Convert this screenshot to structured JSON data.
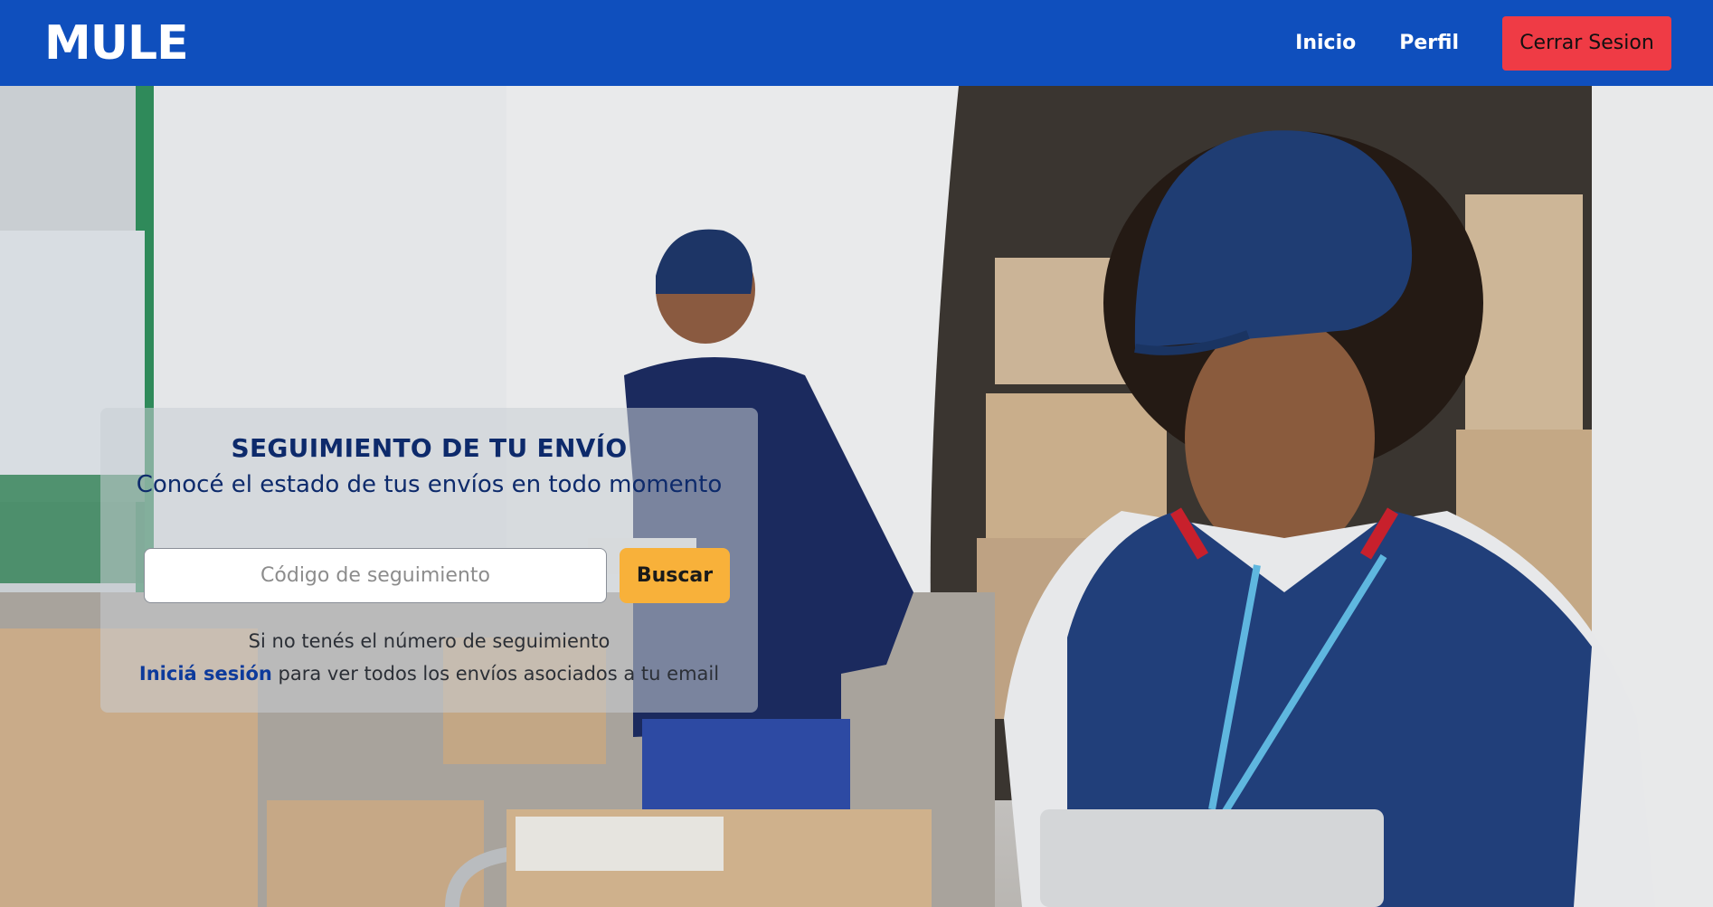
{
  "navbar": {
    "brand": "MULE",
    "links": [
      {
        "label": "Inicio"
      },
      {
        "label": "Perfil"
      }
    ],
    "logout_label": "Cerrar Sesion",
    "colors": {
      "background": "#0f4fbd",
      "logout": "#ef3b45"
    }
  },
  "hero": {
    "image": "delivery-workers-photo",
    "card": {
      "title": "SEGUIMIENTO DE TU ENVÍO",
      "subtitle": "Conocé el estado de tus envíos en todo momento",
      "input_placeholder": "Código de seguimiento",
      "input_value": "",
      "search_label": "Buscar",
      "hint_line1": "Si no tenés el número de seguimiento",
      "login_link": "Iniciá sesión",
      "hint_line2_rest": " para ver todos los envíos asociados a tu email"
    },
    "colors": {
      "title": "#0d2a6b",
      "search_button": "#f8b13a",
      "link": "#0d3a9b"
    }
  }
}
